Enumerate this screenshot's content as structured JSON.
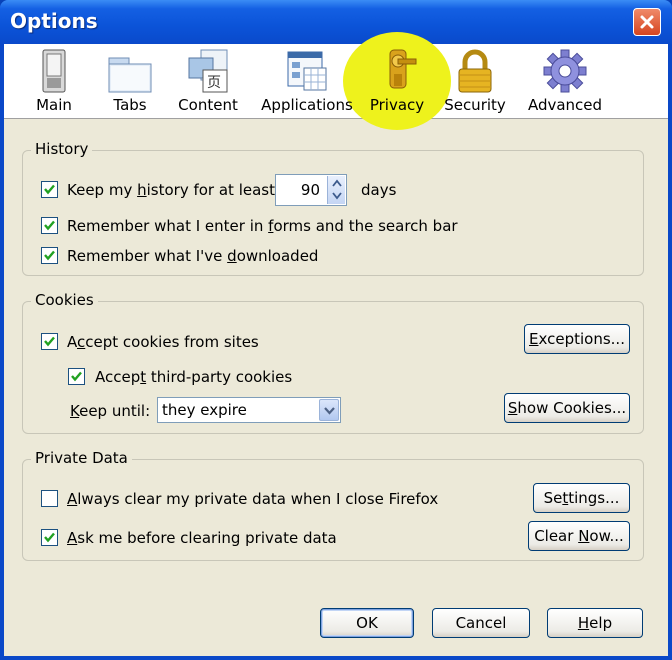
{
  "window": {
    "title": "Options"
  },
  "tabs": [
    {
      "label": "Main",
      "icon": "switch-icon"
    },
    {
      "label": "Tabs",
      "icon": "tabs-folder-icon"
    },
    {
      "label": "Content",
      "icon": "content-page-icon"
    },
    {
      "label": "Applications",
      "icon": "applications-window-icon"
    },
    {
      "label": "Privacy",
      "icon": "privacy-key-icon",
      "selected": true
    },
    {
      "label": "Security",
      "icon": "padlock-icon"
    },
    {
      "label": "Advanced",
      "icon": "gear-icon"
    }
  ],
  "history": {
    "legend": "History",
    "keep_history_pre": "Keep my ",
    "keep_history_u": "h",
    "keep_history_post": "istory for at least",
    "keep_history_checked": true,
    "days_value": "90",
    "days_label": "days",
    "forms_pre": "Remember what I enter in ",
    "forms_u": "f",
    "forms_post": "orms and the search bar",
    "forms_checked": true,
    "downloads_pre": "Remember what I've ",
    "downloads_u": "d",
    "downloads_post": "ownloaded",
    "downloads_checked": true
  },
  "cookies": {
    "legend": "Cookies",
    "accept_pre": "A",
    "accept_u": "c",
    "accept_post": "cept cookies from sites",
    "accept_checked": true,
    "exceptions_pre": "",
    "exceptions_u": "E",
    "exceptions_post": "xceptions...",
    "third_pre": "Accep",
    "third_u": "t",
    "third_post": " third-party cookies",
    "third_checked": true,
    "keep_until_pre": "",
    "keep_until_u": "K",
    "keep_until_post": "eep until:",
    "keep_until_value": "they expire",
    "show_pre": "",
    "show_u": "S",
    "show_post": "how Cookies..."
  },
  "private_data": {
    "legend": "Private Data",
    "always_pre": "",
    "always_u": "A",
    "always_post": "lways clear my private data when I close Firefox",
    "always_checked": false,
    "settings_pre": "Se",
    "settings_u": "t",
    "settings_post": "tings...",
    "ask_pre": "",
    "ask_u": "A",
    "ask_post": "sk me before clearing private data",
    "ask_checked": true,
    "clear_pre": "Clear ",
    "clear_u": "N",
    "clear_post": "ow..."
  },
  "buttons": {
    "ok": "OK",
    "cancel": "Cancel",
    "help_u": "H",
    "help_post": "elp"
  },
  "colors": {
    "titlebar": "#0b53d8",
    "dialog_bg": "#ece9d8",
    "highlight": "#eef21c",
    "checkmark": "#21a121"
  }
}
